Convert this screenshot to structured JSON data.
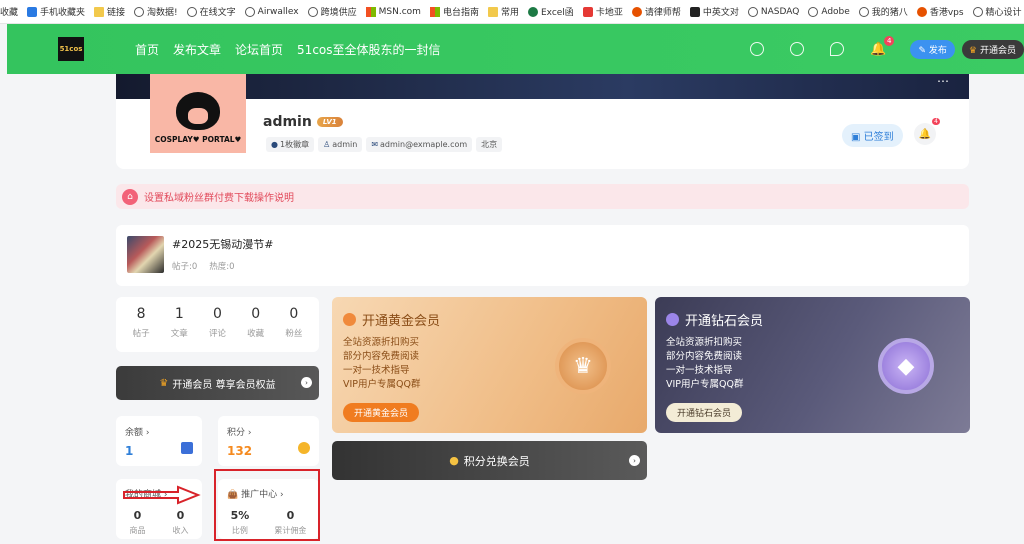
{
  "bookmarks": [
    "收藏",
    "手机收藏夹",
    "链接",
    "淘数据!",
    "在线文字",
    "Airwallex",
    "跨境供应",
    "MSN.com",
    "电台指南",
    "常用",
    "Excel函",
    "卡地亚",
    "请律师帮",
    "中英文对",
    "NASDAQ",
    "Adobe",
    "我的猪八",
    "香港vps",
    "精心设计"
  ],
  "nav": {
    "logo": "51cos",
    "links": [
      "首页",
      "发布文章",
      "论坛首页",
      "51cos至全体股东的一封信"
    ],
    "notif_badge": "4",
    "publish": "发布",
    "vip": "开通会员"
  },
  "profile": {
    "avatar_text": "COSPLAY♥ PORTAL♥",
    "username": "admin",
    "level": "LV1",
    "tags": [
      "1枚徽章",
      "admin",
      "admin@exmaple.com",
      "北京"
    ],
    "checkin": "已签到",
    "bell_badge": "4"
  },
  "notice": "设置私域粉丝群付费下载操作说明",
  "topic": {
    "title": "#2025无锡动漫节#",
    "posts": "帖子:0",
    "heat": "热度:0"
  },
  "stats": [
    {
      "n": "8",
      "l": "帖子"
    },
    {
      "n": "1",
      "l": "文章"
    },
    {
      "n": "0",
      "l": "评论"
    },
    {
      "n": "0",
      "l": "收藏"
    },
    {
      "n": "0",
      "l": "粉丝"
    }
  ],
  "vip_bar": "开通会员 尊享会员权益",
  "balance": {
    "title": "余额 ›",
    "value": "1"
  },
  "points": {
    "title": "积分 ›",
    "value": "132"
  },
  "shop": {
    "title": "我的商城 ›",
    "items": [
      {
        "n": "0",
        "l": "商品"
      },
      {
        "n": "0",
        "l": "收入"
      }
    ]
  },
  "promo": {
    "title": "推广中心 ›",
    "items": [
      {
        "n": "5%",
        "l": "比例"
      },
      {
        "n": "0",
        "l": "累计佣金"
      }
    ]
  },
  "gold": {
    "title": "开通黄金会员",
    "lines": [
      "全站资源折扣购买",
      "部分内容免费阅读",
      "一对一技术指导",
      "VIP用户专属QQ群"
    ],
    "button": "开通黄金会员"
  },
  "diamond": {
    "title": "开通钻石会员",
    "lines": [
      "全站资源折扣购买",
      "部分内容免费阅读",
      "一对一技术指导",
      "VIP用户专属QQ群"
    ],
    "button": "开通钻石会员"
  },
  "points_exchange": "积分兑换会员",
  "colors": {
    "nav_green": "#3bcb63",
    "accent_red": "#d8232a",
    "notice_pink": "#fbe7ea",
    "points_orange": "#f58a1f"
  }
}
